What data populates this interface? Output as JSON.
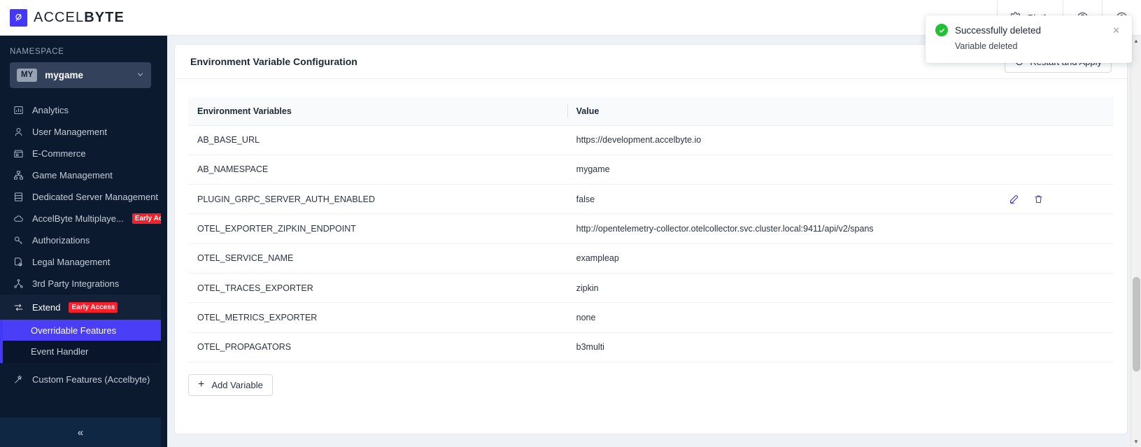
{
  "brand": {
    "name_light": "ACCEL",
    "name_bold": "BYTE",
    "logo_icon": "accelbyte-logo-icon"
  },
  "topbar": {
    "platform_label": "Platfo",
    "gear_icon": "gear-icon",
    "help_icon": "help-circle-icon",
    "account_icon": "user-circle-icon"
  },
  "sidebar": {
    "namespace_label": "NAMESPACE",
    "namespace": {
      "initials": "MY",
      "name": "mygame",
      "caret": "∨"
    },
    "items": [
      {
        "label": "Analytics",
        "icon": "chart-bar-icon"
      },
      {
        "label": "User Management",
        "icon": "user-icon"
      },
      {
        "label": "E-Commerce",
        "icon": "store-icon"
      },
      {
        "label": "Game Management",
        "icon": "sitemap-icon"
      },
      {
        "label": "Dedicated Server Management",
        "icon": "server-icon"
      },
      {
        "label": "AccelByte Multiplaye...",
        "icon": "cloud-icon",
        "badge": "Early Access"
      },
      {
        "label": "Authorizations",
        "icon": "key-icon"
      },
      {
        "label": "Legal Management",
        "icon": "document-check-icon"
      },
      {
        "label": "3rd Party Integrations",
        "icon": "share-nodes-icon"
      }
    ],
    "group": {
      "label": "Extend",
      "icon": "transfer-arrows-icon",
      "badge": "Early Access",
      "children": [
        {
          "label": "Overridable Features",
          "active": true
        },
        {
          "label": "Event Handler",
          "active": false
        }
      ]
    },
    "items_after": [
      {
        "label": "Custom Features (Accelbyte)",
        "icon": "wand-icon"
      }
    ],
    "collapse_icon": "chevron-double-left-icon",
    "collapse_label": "«"
  },
  "card": {
    "title": "Environment Variable Configuration",
    "restart_button": {
      "label": "Restart and Apply",
      "icon": "refresh-icon"
    },
    "add_button": {
      "label": "Add Variable",
      "icon": "plus-icon"
    }
  },
  "table": {
    "headers": [
      "Environment Variables",
      "Value",
      ""
    ],
    "rows": [
      {
        "name": "AB_BASE_URL",
        "value": "https://development.accelbyte.io",
        "actions": false
      },
      {
        "name": "AB_NAMESPACE",
        "value": "mygame",
        "actions": false
      },
      {
        "name": "PLUGIN_GRPC_SERVER_AUTH_ENABLED",
        "value": "false",
        "actions": true
      },
      {
        "name": "OTEL_EXPORTER_ZIPKIN_ENDPOINT",
        "value": "http://opentelemetry-collector.otelcollector.svc.cluster.local:9411/api/v2/spans",
        "actions": false
      },
      {
        "name": "OTEL_SERVICE_NAME",
        "value": "exampleap",
        "actions": false
      },
      {
        "name": "OTEL_TRACES_EXPORTER",
        "value": "zipkin",
        "actions": false
      },
      {
        "name": "OTEL_METRICS_EXPORTER",
        "value": "none",
        "actions": false
      },
      {
        "name": "OTEL_PROPAGATORS",
        "value": "b3multi",
        "actions": false
      }
    ],
    "row_action_icons": {
      "edit": "pencil-icon",
      "delete": "trash-icon"
    }
  },
  "toast": {
    "title": "Successfully deleted",
    "message": "Variable deleted",
    "close_label": "✕",
    "status_icon": "check-circle-icon",
    "accent_color": "#21c035"
  },
  "colors": {
    "accent": "#4338f5",
    "sidebar_bg": "#0b1a2e",
    "badge_red": "#f81e2a",
    "success_green": "#21c035"
  },
  "scrollbar": {
    "up": "▲",
    "down": "▼"
  }
}
